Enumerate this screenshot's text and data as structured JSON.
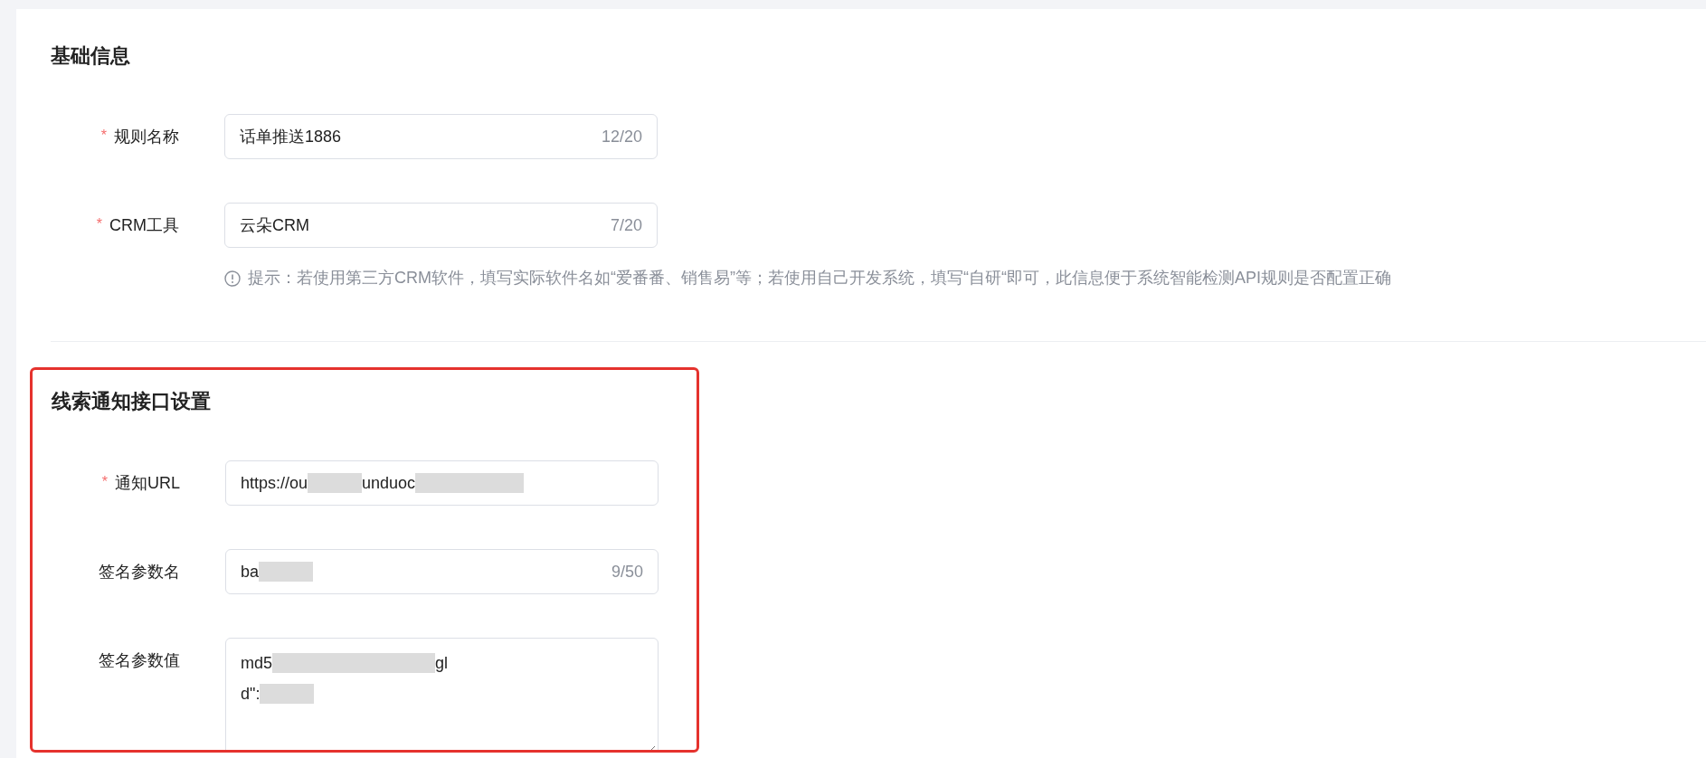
{
  "sections": [
    {
      "title": "基础信息",
      "divider_after": true,
      "fields": [
        {
          "label": "规则名称",
          "required_mark": "*",
          "kind": "input",
          "value": [
            {
              "kind": "text",
              "text": "话单推送1886"
            }
          ],
          "counter": "12/20"
        },
        {
          "label": "CRM工具",
          "required_mark": "*",
          "kind": "input",
          "value": [
            {
              "kind": "text",
              "text": "云朵CRM"
            }
          ],
          "counter": "7/20",
          "hint": "提示：若使用第三方CRM软件，填写实际软件名如“爱番番、销售易”等；若使用自己开发系统，填写“自研“即可，此信息便于系统智能检测API规则是否配置正确"
        }
      ]
    },
    {
      "title": "线索通知接口设置",
      "highlighted": true,
      "fields": [
        {
          "label": "通知URL",
          "required_mark": "*",
          "kind": "input",
          "value": [
            {
              "kind": "text",
              "text": "https://ou"
            },
            {
              "kind": "redacted"
            },
            {
              "kind": "text",
              "text": "unduoc"
            },
            {
              "kind": "redacted"
            },
            {
              "kind": "redacted"
            }
          ]
        },
        {
          "label": "签名参数名",
          "kind": "input",
          "value": [
            {
              "kind": "text",
              "text": "ba"
            },
            {
              "kind": "redacted"
            }
          ],
          "counter": "9/50"
        },
        {
          "label": "签名参数值",
          "kind": "textarea",
          "lines": [
            [
              {
                "kind": "text",
                "text": "md5"
              },
              {
                "kind": "redacted"
              },
              {
                "kind": "redacted"
              },
              {
                "kind": "redacted"
              },
              {
                "kind": "text",
                "text": "gl"
              }
            ],
            [
              {
                "kind": "text",
                "text": "d\":"
              },
              {
                "kind": "redacted"
              }
            ]
          ]
        }
      ]
    }
  ]
}
